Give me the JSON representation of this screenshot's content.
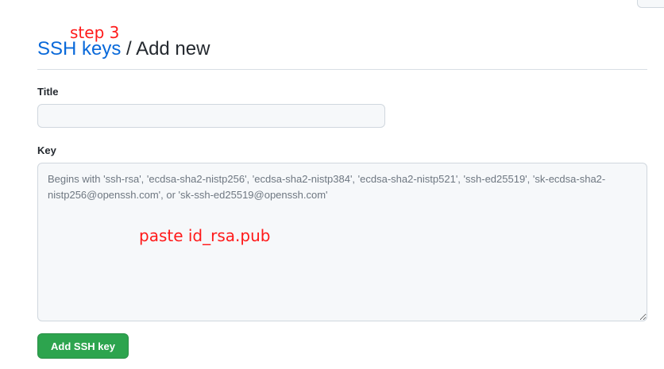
{
  "annotations": {
    "step": "step 3",
    "paste": "paste id_rsa.pub"
  },
  "header": {
    "breadcrumb_link": "SSH keys",
    "separator": " / ",
    "current": "Add new"
  },
  "form": {
    "title_label": "Title",
    "title_value": "",
    "key_label": "Key",
    "key_value": "",
    "key_placeholder": "Begins with 'ssh-rsa', 'ecdsa-sha2-nistp256', 'ecdsa-sha2-nistp384', 'ecdsa-sha2-nistp521', 'ssh-ed25519', 'sk-ecdsa-sha2-nistp256@openssh.com', or 'sk-ssh-ed25519@openssh.com'",
    "submit_label": "Add SSH key"
  },
  "colors": {
    "link": "#0969da",
    "submit_bg": "#2da44e",
    "annotation": "#ff1a1a"
  }
}
